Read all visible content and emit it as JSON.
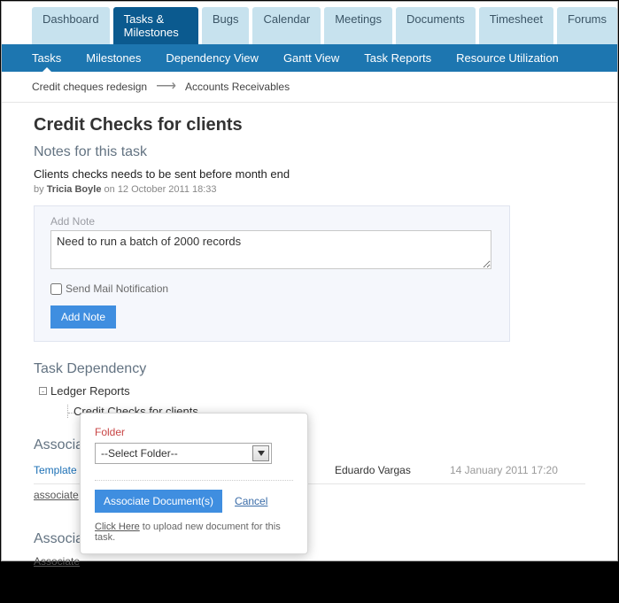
{
  "top_tabs": {
    "items": [
      {
        "label": "Dashboard"
      },
      {
        "label": "Tasks & Milestones"
      },
      {
        "label": "Bugs"
      },
      {
        "label": "Calendar"
      },
      {
        "label": "Meetings"
      },
      {
        "label": "Documents"
      },
      {
        "label": "Timesheet"
      },
      {
        "label": "Forums"
      }
    ],
    "active_index": 1
  },
  "sub_tabs": {
    "items": [
      {
        "label": "Tasks"
      },
      {
        "label": "Milestones"
      },
      {
        "label": "Dependency View"
      },
      {
        "label": "Gantt View"
      },
      {
        "label": "Task Reports"
      },
      {
        "label": "Resource Utilization"
      }
    ],
    "active_index": 0
  },
  "breadcrumb": {
    "parent": "Credit cheques redesign",
    "child": "Accounts Receivables"
  },
  "page": {
    "title": "Credit Checks for clients"
  },
  "notes": {
    "section_title": "Notes for this task",
    "title": "Clients checks needs to be sent before month end",
    "by_prefix": "by ",
    "author": "Tricia Boyle",
    "on_prefix": " on ",
    "date": "12 October 2011 18:33",
    "panel_label": "Add Note",
    "textarea_value": "Need to run a batch of 2000 records",
    "mail_label": "Send Mail Notification",
    "add_btn": "Add Note"
  },
  "dependency": {
    "section_title": "Task Dependency",
    "parent": "Ledger Reports",
    "child": "Credit Checks for clients"
  },
  "documents": {
    "section_title": "Associated Documents",
    "rows": [
      {
        "name": "Template",
        "author": "Eduardo Vargas",
        "date": "14 January 2011 17:20"
      }
    ],
    "associate_link": "associate"
  },
  "forums": {
    "section_title": "Associat",
    "associate_link": "Associate"
  },
  "popup": {
    "folder_label": "Folder",
    "select_value": "--Select Folder--",
    "associate_btn": "Associate Document(s)",
    "cancel": "Cancel",
    "click_here": "Click Here",
    "upload_rest": " to upload new document for this task."
  }
}
